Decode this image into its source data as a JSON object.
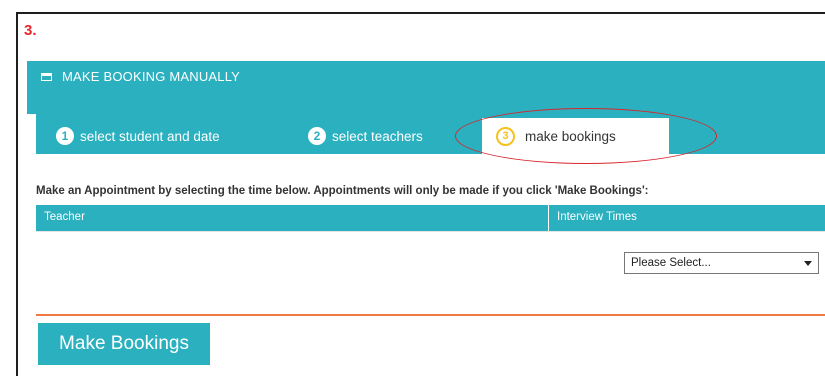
{
  "step_label": "3.",
  "panel": {
    "title": "MAKE BOOKING MANUALLY",
    "icon": "window-icon"
  },
  "tabs": [
    {
      "number": "1",
      "label": "select student and date",
      "active": false
    },
    {
      "number": "2",
      "label": "select teachers",
      "active": false
    },
    {
      "number": "3",
      "label": "make bookings",
      "active": true
    }
  ],
  "instructions": "Make an Appointment by selecting the time below. Appointments will only be made if you click 'Make Bookings':",
  "table": {
    "headers": [
      "Teacher",
      "Interview Times"
    ],
    "select_value": "Please Select..."
  },
  "submit_label": "Make Bookings",
  "colors": {
    "accent": "#2bb0bf",
    "step_number": "#e8262b",
    "highlight_ellipse": "#d6262c",
    "divider": "#f07a46",
    "active_tab_number": "#f4c21c"
  }
}
